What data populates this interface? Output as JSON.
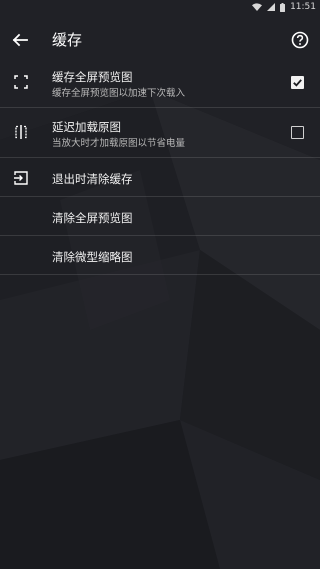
{
  "status_bar": {
    "time": "11:51",
    "icons": [
      "wifi-icon",
      "signal-icon",
      "battery-icon"
    ]
  },
  "app_bar": {
    "title": "缓存",
    "back_icon": "arrow-left-icon",
    "help_icon": "help-circle-icon"
  },
  "settings": [
    {
      "title": "缓存全屏预览图",
      "subtitle": "缓存全屏预览图以加速下次载入",
      "icon": "fullscreen-corners-icon",
      "checked": true
    },
    {
      "title": "延迟加载原图",
      "subtitle": "当放大时才加载原图以节省电量",
      "icon": "split-view-icon",
      "checked": false
    },
    {
      "title": "退出时清除缓存",
      "icon": "exit-to-app-icon"
    },
    {
      "title": "清除全屏预览图"
    },
    {
      "title": "清除微型缩略图"
    }
  ],
  "colors": {
    "background": "#1c1d21",
    "text_primary": "#f2f2f2",
    "text_secondary": "#b8b8b8",
    "divider": "rgba(255,255,255,0.12)"
  }
}
